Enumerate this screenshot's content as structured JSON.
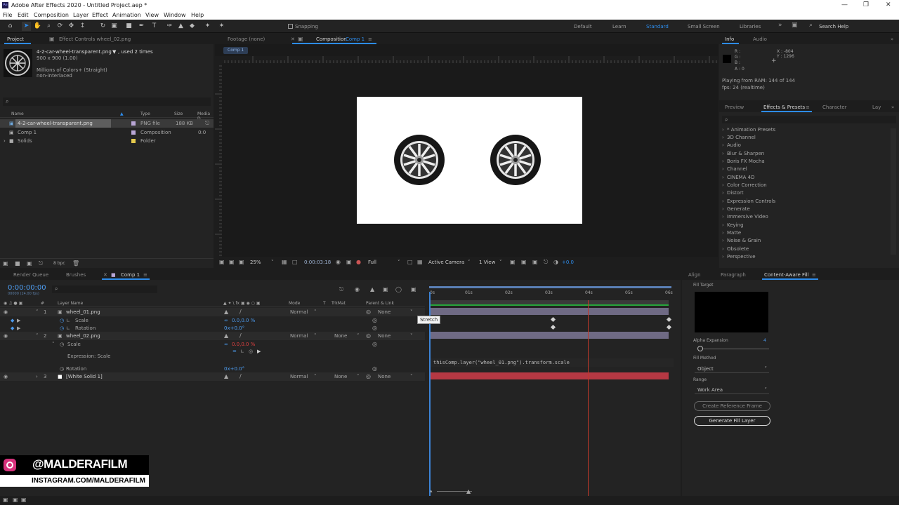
{
  "app": {
    "title": "Adobe After Effects 2020 - Untitled Project.aep *",
    "logo": "Ae"
  },
  "menu": [
    "File",
    "Edit",
    "Composition",
    "Layer",
    "Effect",
    "Animation",
    "View",
    "Window",
    "Help"
  ],
  "toolbar": {
    "snapping": "Snapping",
    "workspaces": [
      "Default",
      "Learn",
      "Standard",
      "Small Screen",
      "Libraries"
    ],
    "search_placeholder": "Search Help"
  },
  "project": {
    "tab": "Project",
    "tab2": "Effect Controls wheel_02.png",
    "file_name": "4-2-car-wheel-transparent.png",
    "used": ", used 2 times",
    "dims": "900 x 900 (1.00)",
    "colors": "Millions of Colors+ (Straight)",
    "interlace": "non-interlaced",
    "headers": [
      "Name",
      "Type",
      "Size",
      "Media D"
    ],
    "items": [
      {
        "name": "4-2-car-wheel-transparent.png",
        "type": "PNG file",
        "size": "188 KB",
        "color": "#b9a6d6"
      },
      {
        "name": "Comp 1",
        "type": "Composition",
        "size": "",
        "media": "0:0",
        "color": "#b9a6d6"
      },
      {
        "name": "Solids",
        "type": "Folder",
        "size": "",
        "color": "#e5c94c"
      }
    ],
    "bpc": "8 bpc"
  },
  "viewer": {
    "tabs": {
      "footage": "Footage (none)",
      "comp": "Composition",
      "comp_name": "Comp 1"
    },
    "breadcrumb": "Comp 1",
    "zoom": "25%",
    "time": "0:00:03:18",
    "quality": "Full",
    "camera": "Active Camera",
    "view": "1 View",
    "exposure": "+0.0"
  },
  "info": {
    "tab": "Info",
    "tab2": "Audio",
    "r": "R :",
    "g": "G :",
    "b": "B :",
    "a": "A : 0",
    "x": "X : -804",
    "y": "Y : 1296",
    "playing": "Playing from RAM: 144 of 144",
    "fps": "fps: 24 (realtime)"
  },
  "effects": {
    "tabs": [
      "Preview",
      "Effects & Presets",
      "Character",
      "Lay"
    ],
    "items": [
      "* Animation Presets",
      "3D Channel",
      "Audio",
      "Blur & Sharpen",
      "Boris FX Mocha",
      "Channel",
      "CINEMA 4D",
      "Color Correction",
      "Distort",
      "Expression Controls",
      "Generate",
      "Immersive Video",
      "Keying",
      "Matte",
      "Noise & Grain",
      "Obsolete",
      "Perspective"
    ]
  },
  "timeline": {
    "tabs": [
      "Render Queue",
      "Brushes",
      "Comp 1"
    ],
    "timecode": "0:00:00:00",
    "timecode_sub": "00000 (24.00 fps)",
    "headers": {
      "layer_name": "Layer Name",
      "mode": "Mode",
      "t": "T",
      "trkmat": "TrkMat",
      "parent": "Parent & Link"
    },
    "ruler": [
      "0s",
      "01s",
      "02s",
      "03s",
      "04s",
      "05s",
      "06s"
    ],
    "layers": [
      {
        "num": "1",
        "name": "wheel_01.png",
        "mode": "Normal",
        "parent": "None"
      },
      {
        "num": "2",
        "name": "wheel_02.png",
        "mode": "Normal",
        "trkmat": "None",
        "parent": "None"
      },
      {
        "num": "3",
        "name": "[White Solid 1]",
        "mode": "Normal",
        "trkmat": "None",
        "parent": "None"
      }
    ],
    "props": {
      "scale": "Scale",
      "scale_val": "0.0,0.0 %",
      "rotation": "Rotation",
      "rotation_val": "0x+0.0°",
      "scale2": "Scale",
      "scale2_val": "0.0,0.0 %",
      "expr_label": "Expression: Scale",
      "rotation2": "Rotation",
      "rotation2_val": "0x+0.0°"
    },
    "expression": "thisComp.layer(\"wheel_01.png\").transform.scale",
    "tooltip": "Stretch"
  },
  "caf": {
    "tabs": [
      "Align",
      "Paragraph",
      "Content-Aware Fill"
    ],
    "fill_target": "Fill Target",
    "alpha": "Alpha Expansion",
    "alpha_val": "4",
    "fill_method": "Fill Method",
    "method_val": "Object",
    "range": "Range",
    "range_val": "Work Area",
    "btn1": "Create Reference Frame",
    "btn2": "Generate Fill Layer"
  },
  "watermark": {
    "handle": "@MALDERAFILM",
    "url": "INSTAGRAM.COM/MALDERAFILM"
  },
  "colors": {
    "accent": "#2d8ceb",
    "layer_bar": "#6f6a84",
    "solid_bar": "#b53843",
    "work_green": "#27a53b",
    "playhead": "#c0392b"
  }
}
